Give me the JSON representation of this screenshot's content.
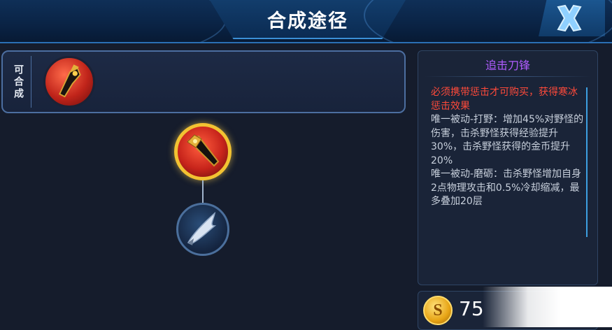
{
  "header": {
    "title": "合成途径"
  },
  "compose_panel": {
    "label": "可合成"
  },
  "item": {
    "name": "追击刀锋",
    "requirement": "必须携带惩击才可购买，获得寒冰惩击效果",
    "passive_1": "唯一被动-打野：增加45%对野怪的伤害，击杀野怪获得经验提升30%，击杀野怪获得的金币提升20%",
    "passive_2": "唯一被动-磨砺：击杀野怪增加自身2点物理攻击和0.5%冷却缩减，最多叠加20层",
    "price": "75"
  },
  "colors": {
    "name": "#b05cff",
    "requirement": "#ff4a3a",
    "selected_ring": "#f2c232"
  },
  "icons": {
    "close": "close-x-icon",
    "compose_item": "red-blade-item-icon",
    "tree_top": "pursuit-blade-icon",
    "tree_bottom": "hunting-dagger-icon",
    "currency": "gold-coin-icon"
  }
}
